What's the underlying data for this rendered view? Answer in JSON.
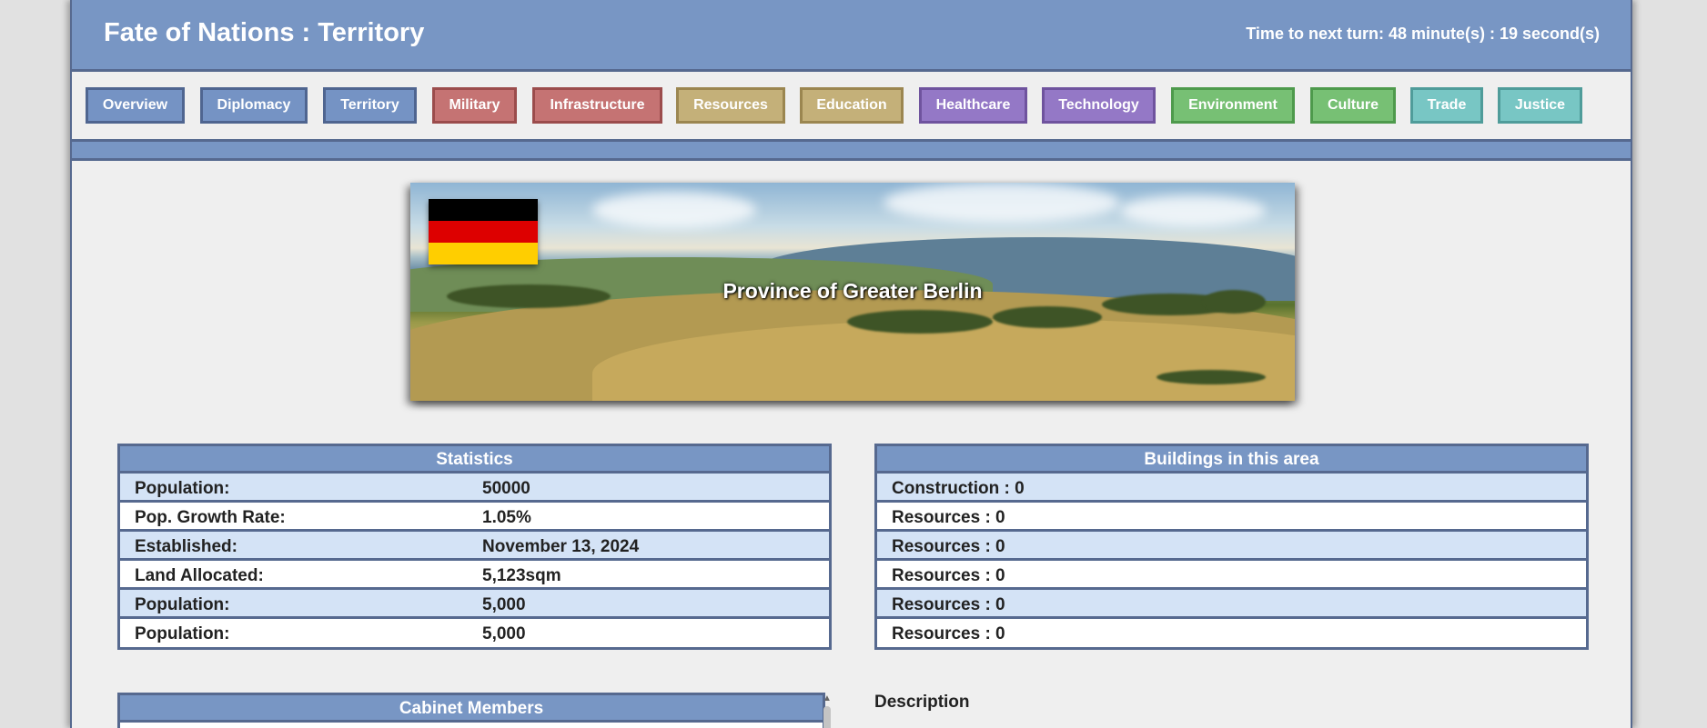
{
  "header": {
    "title": "Fate of Nations : Territory",
    "timer": "Time to next turn: 48 minute(s) : 19 second(s)"
  },
  "nav": [
    {
      "label": "Overview",
      "color": "blue"
    },
    {
      "label": "Diplomacy",
      "color": "blue"
    },
    {
      "label": "Territory",
      "color": "blue"
    },
    {
      "label": "Military",
      "color": "red"
    },
    {
      "label": "Infrastructure",
      "color": "red"
    },
    {
      "label": "Resources",
      "color": "tan"
    },
    {
      "label": "Education",
      "color": "tan"
    },
    {
      "label": "Healthcare",
      "color": "purple"
    },
    {
      "label": "Technology",
      "color": "purple"
    },
    {
      "label": "Environment",
      "color": "green"
    },
    {
      "label": "Culture",
      "color": "green"
    },
    {
      "label": "Trade",
      "color": "teal"
    },
    {
      "label": "Justice",
      "color": "teal"
    }
  ],
  "banner": {
    "caption": "Province of Greater Berlin",
    "flag_icon": "germany-flag-icon"
  },
  "statistics": {
    "title": "Statistics",
    "rows": [
      {
        "label": "Population:",
        "value": "50000"
      },
      {
        "label": "Pop. Growth Rate:",
        "value": "1.05%"
      },
      {
        "label": "Established:",
        "value": "November 13, 2024"
      },
      {
        "label": "Land Allocated:",
        "value": "5,123sqm"
      },
      {
        "label": "Population:",
        "value": "5,000"
      },
      {
        "label": "Population:",
        "value": "5,000"
      }
    ]
  },
  "buildings": {
    "title": "Buildings in this area",
    "rows": [
      "Construction : 0",
      "Resources : 0",
      "Resources : 0",
      "Resources : 0",
      "Resources : 0",
      "Resources : 0"
    ]
  },
  "cabinet": {
    "title": "Cabinet Members"
  },
  "description": {
    "label": "Description"
  },
  "colors": {
    "header": "#7896c4",
    "border": "#56698f",
    "row_alt": "#d4e3f6"
  }
}
